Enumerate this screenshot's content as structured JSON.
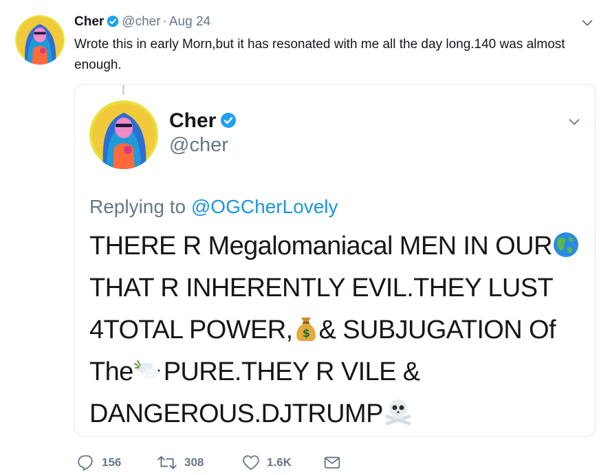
{
  "tweet": {
    "author_name": "Cher",
    "author_handle": "@cher",
    "date": "Aug 24",
    "separator": "·",
    "text": "Wrote this in early Morn,but it has resonated with me all the day long.140 was almost enough."
  },
  "quoted": {
    "author_name": "Cher",
    "author_handle": "@cher",
    "replying_prefix": "Replying to",
    "replying_to": "@OGCherLovely",
    "segments": [
      "THERE R Megalomaniacal MEN IN OUR",
      "THAT R INHERENTLY EVIL.THEY LUST 4TOTAL POWER,",
      "& SUBJUGATION Of The",
      "PURE.THEY R VILE & DANGEROUS.DJTRUMP"
    ],
    "emojis": [
      "globe-americas",
      "money-bag",
      "dove",
      "skull-and-crossbones"
    ]
  },
  "actions": {
    "reply_count": "156",
    "retweet_count": "308",
    "like_count": "1.6K"
  },
  "colors": {
    "verified": "#1da1f2",
    "link": "#1b95e0",
    "muted": "#657786",
    "border": "#e1e8ed"
  }
}
